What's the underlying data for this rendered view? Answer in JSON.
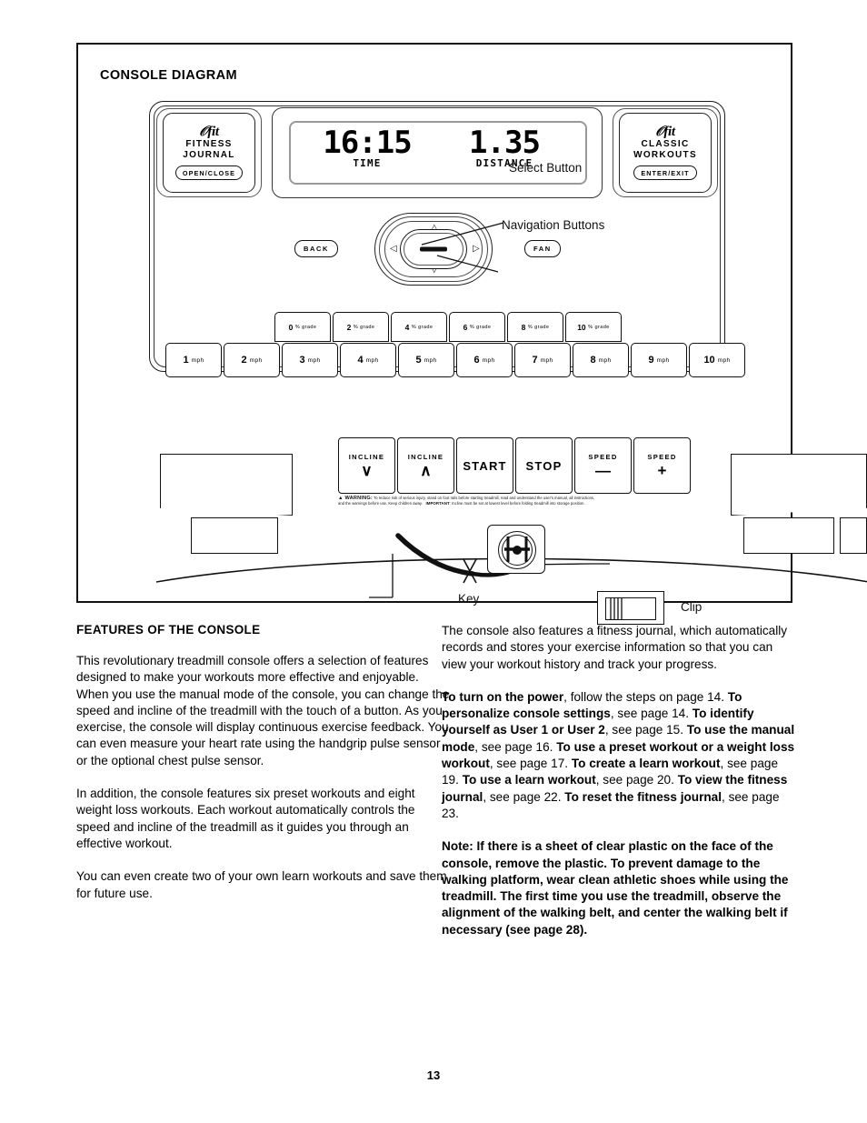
{
  "diagram": {
    "title": "CONSOLE DIAGRAM",
    "ifit_left": {
      "logo": "fit",
      "line1": "FITNESS",
      "line2": "JOURNAL",
      "button": "OPEN/CLOSE"
    },
    "ifit_right": {
      "logo": "fit",
      "line1": "CLASSIC",
      "line2": "WORKOUTS",
      "button": "ENTER/EXIT"
    },
    "lcd": {
      "time_value": "16:15",
      "time_label": "TIME",
      "distance_value": "1.35",
      "distance_label": "DISTANCE"
    },
    "back_button": "BACK",
    "fan_button": "FAN",
    "callouts": {
      "select": "Select Button",
      "navigation": "Navigation Buttons",
      "key": "Key",
      "clip": "Clip"
    },
    "nav_arrows": {
      "up": "△",
      "down": "▽",
      "left": "◁",
      "right": "▷"
    },
    "grade_buttons": [
      {
        "num": "0",
        "unit": "% grade"
      },
      {
        "num": "2",
        "unit": "% grade"
      },
      {
        "num": "4",
        "unit": "% grade"
      },
      {
        "num": "6",
        "unit": "% grade"
      },
      {
        "num": "8",
        "unit": "% grade"
      },
      {
        "num": "10",
        "unit": "% grade"
      }
    ],
    "speed_buttons": [
      {
        "num": "1",
        "unit": "mph"
      },
      {
        "num": "2",
        "unit": "mph"
      },
      {
        "num": "3",
        "unit": "mph"
      },
      {
        "num": "4",
        "unit": "mph"
      },
      {
        "num": "5",
        "unit": "mph"
      },
      {
        "num": "6",
        "unit": "mph"
      },
      {
        "num": "7",
        "unit": "mph"
      },
      {
        "num": "8",
        "unit": "mph"
      },
      {
        "num": "9",
        "unit": "mph"
      },
      {
        "num": "10",
        "unit": "mph"
      }
    ],
    "control_buttons": [
      {
        "label": "INCLINE",
        "glyph": "∨",
        "big": false
      },
      {
        "label": "INCLINE",
        "glyph": "∧",
        "big": false
      },
      {
        "label": "START",
        "glyph": "",
        "big": true
      },
      {
        "label": "STOP",
        "glyph": "",
        "big": true
      },
      {
        "label": "SPEED",
        "glyph": "—",
        "big": false
      },
      {
        "label": "SPEED",
        "glyph": "+",
        "big": false
      }
    ],
    "warning": {
      "head": "▲ WARNING:",
      "line1": "To reduce risk of serious injury, stand on foot rails before starting treadmill, read and understand the user's manual, all instructions,",
      "line2_a": "and the warnings before use.  Keep children away.",
      "line2_important": "IMPORTANT",
      "line2_b": ": Incline must be set at lowest level before folding treadmill into storage position."
    }
  },
  "content": {
    "section_heading": "FEATURES OF THE CONSOLE",
    "left_paragraphs": [
      "This revolutionary treadmill console offers a selection of features designed to make your workouts more effective and enjoyable. When you use the manual mode of the console, you can change the speed and incline of the treadmill with the touch of a button. As you exercise, the console will display continuous exercise feedback. You can even measure your heart rate using the handgrip pulse sensor or the optional chest pulse sensor.",
      "In addition, the console features six preset workouts and eight weight loss workouts. Each workout automatically controls the speed and incline of the treadmill as it guides you through an effective workout.",
      "You can even create two of your own learn workouts and save them for future use."
    ],
    "right_paragraph_1": "The console also features a fitness journal, which automatically records and stores your exercise information so that you can view your workout history and track your progress.",
    "right_paragraph_2": "To turn on the power, follow the steps on page 14. To personalize console settings, see page 14. To identify yourself as User 1 or User 2, see page 15. To use the manual mode, see page 16. To use a preset workout or a weight loss workout, see page 17. To create a learn workout, see page 19. To use a learn workout, see page 20. To view the fitness journal, see page 22. To reset the fitness journal, see page 23.",
    "right_paragraph_3": "Note: If there is a sheet of clear plastic on the face of the console, remove the plastic. To prevent damage to the walking platform, wear clean athletic shoes while using the treadmill. The first time you use the treadmill, observe the alignment of the walking belt, and center the walking belt if necessary (see page 28)."
  },
  "page_number": "13"
}
